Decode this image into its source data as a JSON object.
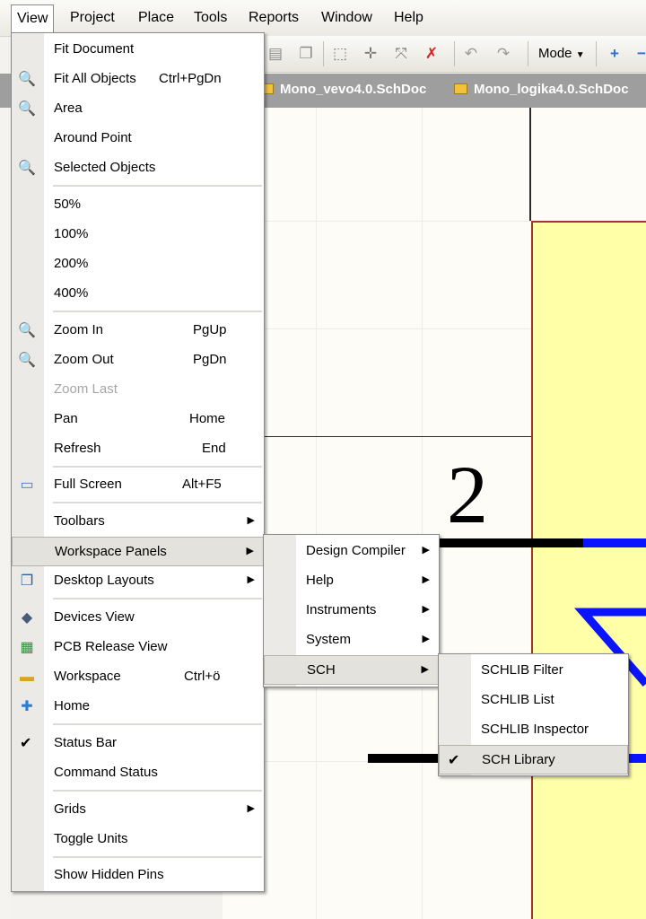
{
  "menubar": {
    "items": [
      "View",
      "Project",
      "Place",
      "Tools",
      "Reports",
      "Window",
      "Help"
    ]
  },
  "toolbar": {
    "mode_label": "Mode"
  },
  "tabs": [
    "Mono_vevo4.0.SchDoc",
    "Mono_logika4.0.SchDoc"
  ],
  "canvas": {
    "region_number": "2",
    "wire_color": "#0a14ff",
    "sheet_fill": "#ffffa8"
  },
  "view_menu": {
    "fit_document": "Fit Document",
    "fit_all_objects": "Fit All Objects",
    "fit_all_objects_shortcut": "Ctrl+PgDn",
    "area": "Area",
    "around_point": "Around Point",
    "selected_objects": "Selected Objects",
    "zoom_50": "50%",
    "zoom_100": "100%",
    "zoom_200": "200%",
    "zoom_400": "400%",
    "zoom_in": "Zoom In",
    "zoom_in_shortcut": "PgUp",
    "zoom_out": "Zoom Out",
    "zoom_out_shortcut": "PgDn",
    "zoom_last": "Zoom Last",
    "pan": "Pan",
    "pan_shortcut": "Home",
    "refresh": "Refresh",
    "refresh_shortcut": "End",
    "full_screen": "Full Screen",
    "full_screen_shortcut": "Alt+F5",
    "toolbars": "Toolbars",
    "workspace_panels": "Workspace Panels",
    "desktop_layouts": "Desktop Layouts",
    "devices_view": "Devices View",
    "pcb_release_view": "PCB Release View",
    "workspace": "Workspace",
    "workspace_shortcut": "Ctrl+ö",
    "home": "Home",
    "status_bar": "Status Bar",
    "command_status": "Command Status",
    "grids": "Grids",
    "toggle_units": "Toggle Units",
    "show_hidden_pins": "Show Hidden Pins"
  },
  "panels_menu": {
    "design_compiler": "Design Compiler",
    "help": "Help",
    "instruments": "Instruments",
    "system": "System",
    "sch": "SCH"
  },
  "sch_menu": {
    "schlib_filter": "SCHLIB Filter",
    "schlib_list": "SCHLIB List",
    "schlib_inspector": "SCHLIB Inspector",
    "sch_library": "SCH Library"
  }
}
